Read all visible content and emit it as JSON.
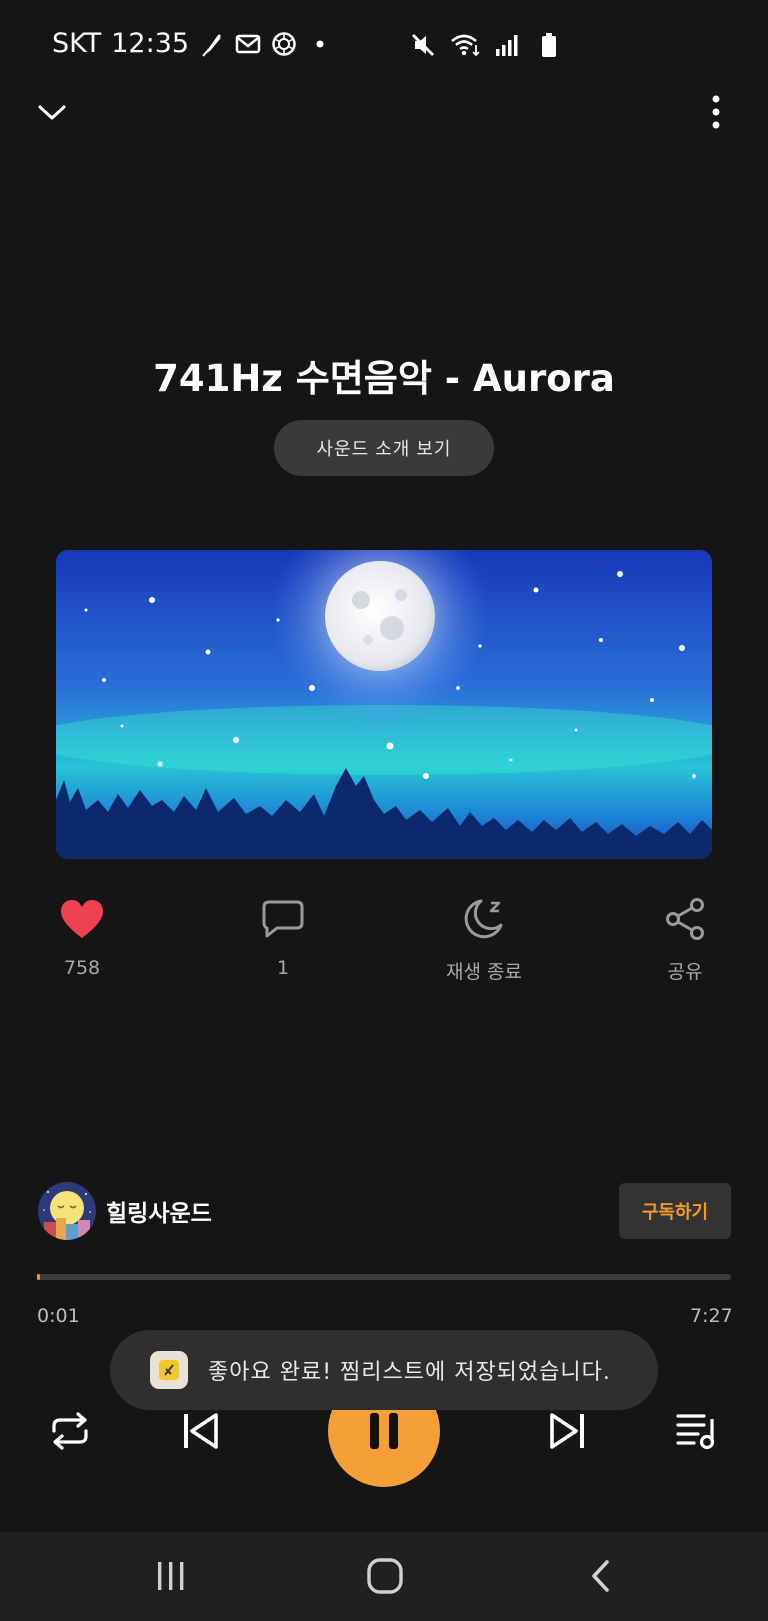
{
  "status_bar": {
    "carrier": "SKT",
    "time": "12:35",
    "notification_icons": [
      "feather-icon",
      "mail-icon",
      "aperture-icon",
      "dot-icon"
    ],
    "system_icons": [
      "mute-icon",
      "wifi-icon",
      "signal-icon",
      "battery-icon"
    ]
  },
  "top_bar": {
    "collapse_icon": "chevron-down-icon",
    "more_icon": "more-vertical-icon"
  },
  "track": {
    "title": "741Hz 수면음악 - Aurora",
    "intro_button": "사운드 소개 보기"
  },
  "actions": {
    "like_count": "758",
    "comment_count": "1",
    "sleep_timer_label": "재생 종료",
    "share_label": "공유"
  },
  "channel": {
    "name": "힐링사운드",
    "subscribe_label": "구독하기"
  },
  "playback": {
    "current_time": "0:01",
    "total_time": "7:27",
    "progress_fraction": 0.002
  },
  "toast": {
    "message": "좋아요 완료! 찜리스트에 저장되었습니다."
  },
  "colors": {
    "background": "#151515",
    "accent": "#f5a037",
    "like": "#ee4152"
  }
}
